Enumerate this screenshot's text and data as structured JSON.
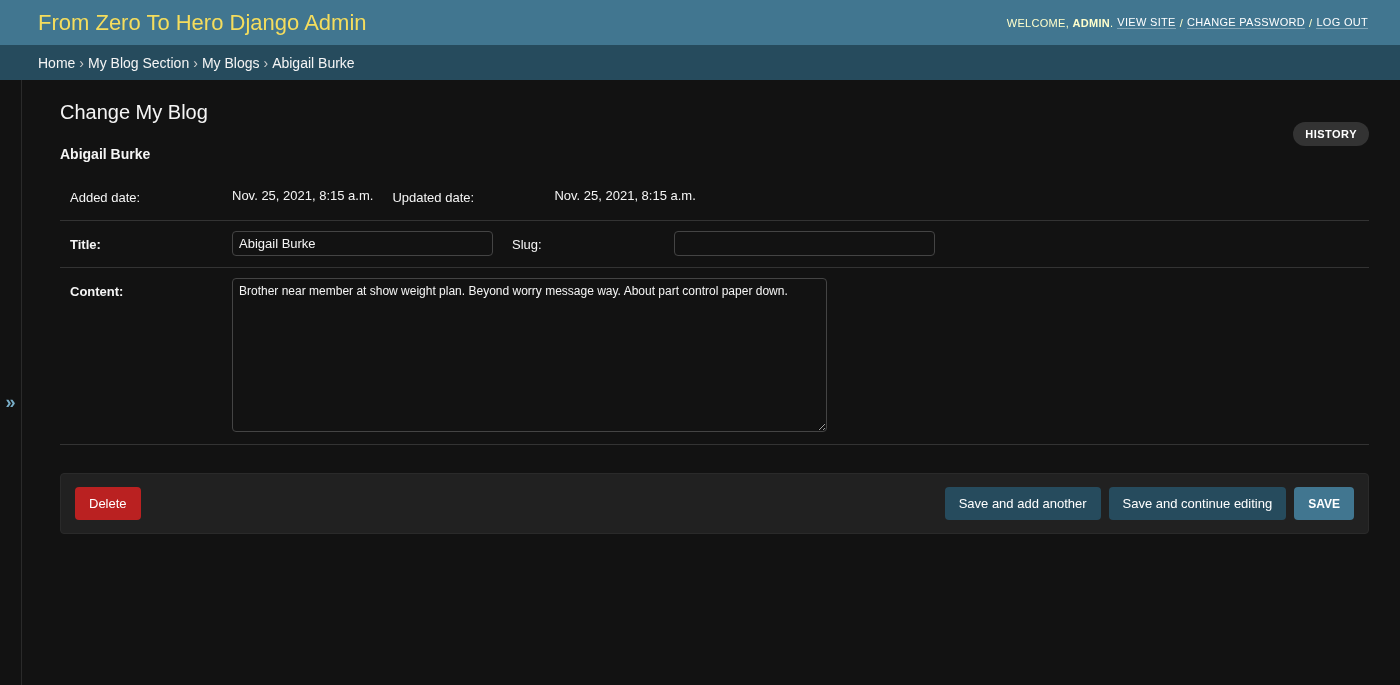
{
  "header": {
    "title": "From Zero To Hero Django Admin",
    "welcome": "WELCOME, **ADMIN**.",
    "separator": "/",
    "links": [
      "VIEW SITE",
      "CHANGE PASSWORD",
      "LOG OUT"
    ]
  },
  "breadcrumbs": {
    "separator": "›",
    "items": [
      "Home",
      "My Blog Section",
      "My Blogs",
      "Abigail Burke"
    ]
  },
  "sidebar_toggle": "»",
  "page_title": "Change My Blog",
  "history_button": "HISTORY",
  "object_title": "Abigail Burke",
  "rows": [
    {
      "fields": [
        {
          "kind": "readonly",
          "label": "Added date:",
          "required": false,
          "value": "Nov. 25, 2021, 8:15 a.m."
        },
        {
          "kind": "readonly",
          "label": "Updated date:",
          "required": false,
          "value": "Nov. 25, 2021, 8:15 a.m."
        }
      ]
    },
    {
      "fields": [
        {
          "kind": "input",
          "label": "Title:",
          "required": true,
          "value": "Abigail Burke"
        },
        {
          "kind": "input",
          "label": "Slug:",
          "required": false
        }
      ]
    },
    {
      "fields": [
        {
          "kind": "textarea",
          "label": "Content:",
          "required": true,
          "value": "Brother near member at show weight plan. Beyond worry message way. About part control paper down."
        }
      ]
    }
  ],
  "buttons": [
    {
      "kind": "delete",
      "label": "Delete"
    },
    {
      "kind": "secondary",
      "label": "Save and add another"
    },
    {
      "kind": "secondary",
      "label": "Save and continue editing"
    },
    {
      "kind": "default",
      "label": "SAVE"
    }
  ]
}
